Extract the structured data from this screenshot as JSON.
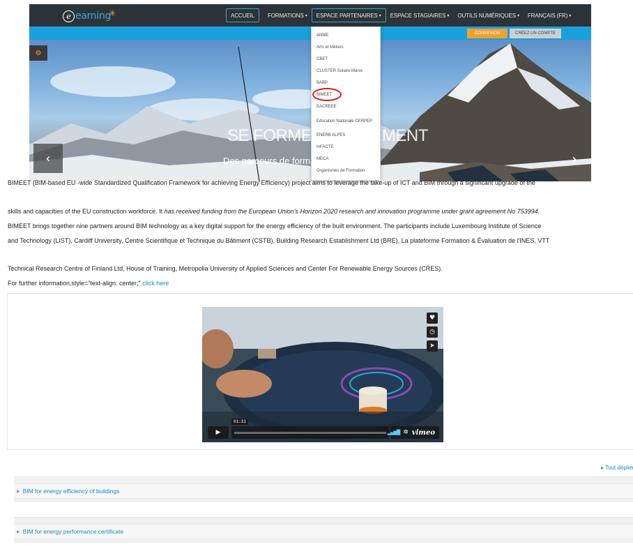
{
  "header": {
    "logo_text": "earning",
    "logo_letter": "e",
    "nav": [
      {
        "label": "ACCUEIL",
        "caret": ""
      },
      {
        "label": "FORMATIONS",
        "caret": "▾"
      },
      {
        "label": "ESPACE PARTENAIRES",
        "caret": "▾"
      },
      {
        "label": "ESPACE STAGIAIRES",
        "caret": "▾"
      },
      {
        "label": "OUTILS NUMÉRIQUES",
        "caret": "▾"
      },
      {
        "label": "FRANÇAIS (FR)",
        "caret": "▾"
      }
    ],
    "connexion": "CONNEXION",
    "create_account": "CRÉEZ UN COMPTE"
  },
  "hero": {
    "title": "SE FORMER AUTREMENT",
    "subtitle": "Des parcours de formation modulables",
    "gear_icon": "⚙",
    "prev": "‹",
    "next": "›"
  },
  "dropdown": {
    "items": [
      "ANME",
      "Arts et Métiers",
      "CBET",
      "CLUSTER Solaire Maroc",
      "BABP",
      "BIMEET",
      "EACREEE",
      "Education Nationale CERPEP",
      "ENERB ALPES",
      "InFACTE",
      "MECA",
      "Organismes de Formation"
    ],
    "highlighted": "BIMEET"
  },
  "article": {
    "p1": "BIMEET (BIM-based EU -wide Standardized Qualification Framework for achieving Energy Efficiency) project aims to leverage the take-up of ICT and BIM through a significant upgrade of the",
    "p2_a": "skills and capacities of the EU construction workforce. It ",
    "p2_b": "has received funding from the European Union's Horizon 2020 research and innovation programme under grant agreement No 753994.",
    "p3": "BIMEET brings together nine partners around BIM technology as a key digital support for the energy efficiency of the built environment. The participants include Luxembourg Institute of Science",
    "p4": "and Technology (LIST), Cardiff University, Centre Scientifique et Technique du Bâtiment (CSTB), Building Research Establishment Ltd (BRE), La plateforme Formation & Évaluation de l'INES, VTT",
    "p5": "Technical Research Centre of Finland Ltd, House of Training, Metropolia University of Applied Sciences and Center For Renewable Energy Sources (CRES).",
    "p6_a": "For further information,style=\"text-align: center;\" ",
    "p6_link": "click here"
  },
  "video": {
    "time": "01:31",
    "brand": "vimeo",
    "icons": [
      "heart-icon",
      "clock-icon",
      "send-icon"
    ]
  },
  "expand_all": "▸ Tout déplier",
  "sections": [
    {
      "label": "BIM for energy efficiency of buildings"
    },
    {
      "label": "BIM for energy performance certificate"
    }
  ]
}
